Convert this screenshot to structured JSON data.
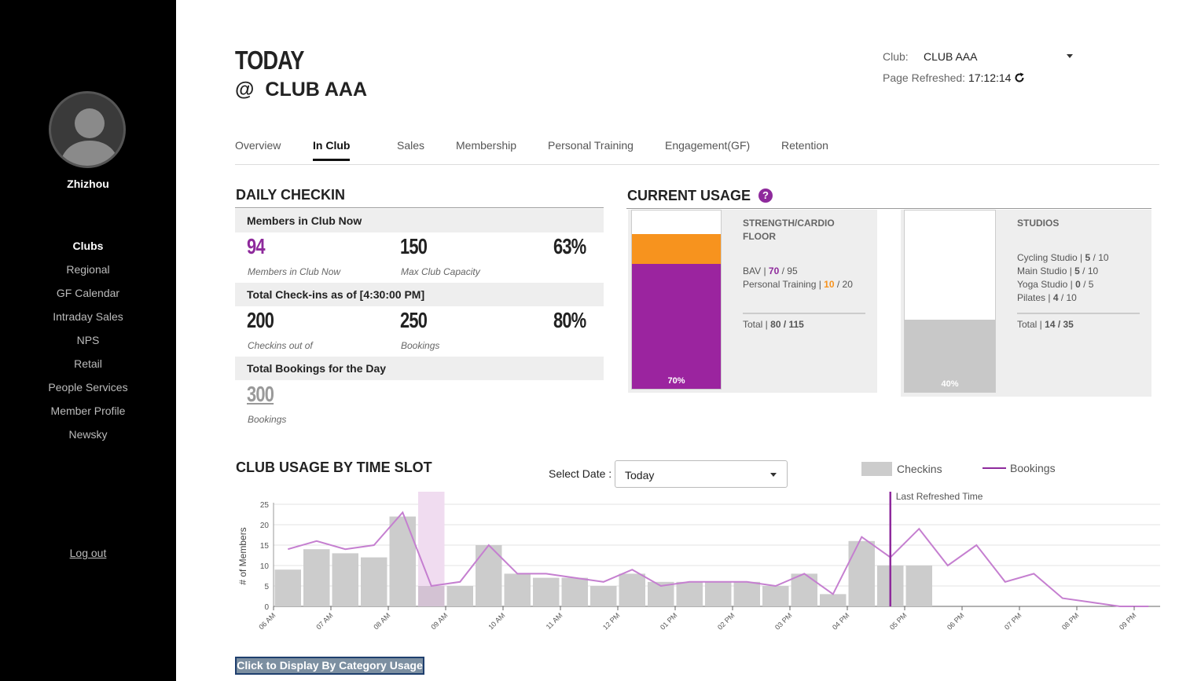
{
  "sidebar": {
    "username": "Zhizhou",
    "items": [
      {
        "label": "Clubs",
        "active": true
      },
      {
        "label": "Regional"
      },
      {
        "label": "GF Calendar"
      },
      {
        "label": "Intraday Sales"
      },
      {
        "label": "NPS"
      },
      {
        "label": "Retail"
      },
      {
        "label": "People Services"
      },
      {
        "label": "Member Profile"
      },
      {
        "label": "Newsky"
      }
    ],
    "logout": "Log out"
  },
  "header": {
    "title": "TODAY",
    "at": "@",
    "club": "CLUB AAA"
  },
  "club_select": {
    "label": "Club:",
    "value": "CLUB AAA"
  },
  "refresh": {
    "label": "Page Refreshed:",
    "time": "17:12:14",
    "icon": "refresh-icon"
  },
  "tabs": [
    "Overview",
    "In Club",
    "Sales",
    "Membership",
    "Personal Training",
    "Engagement(GF)",
    "Retention"
  ],
  "active_tab": "In Club",
  "daily_checkin": {
    "title": "DAILY CHECKIN",
    "members_header": "Members in Club Now",
    "members_now": "94",
    "members_now_cap": "Members in Club Now",
    "capacity": "150",
    "capacity_cap": "Max Club Capacity",
    "members_pct": "63%",
    "checkins_header": "Total Check-ins as of [4:30:00 PM]",
    "checkins": "200",
    "checkins_cap": "Checkins out of",
    "bookings": "250",
    "bookings_cap": "Bookings",
    "checkins_pct": "80%",
    "bookings_header": "Total Bookings for the Day",
    "day_bookings": "300",
    "day_bookings_cap": "Bookings"
  },
  "current_usage": {
    "title": "CURRENT USAGE",
    "help": "?",
    "floor": {
      "title1": "STRENGTH/CARDIO",
      "title2": "FLOOR",
      "l1a": "BAV | ",
      "l1b": "70",
      "l1c": " / 95",
      "l2a": "Personal Training | ",
      "l2b": "10",
      "l2c": " / 20",
      "l3a": "Total | ",
      "l3b": "80 / 115",
      "pct": "70%",
      "fill_purple": 0.7,
      "fill_orange": 0.17,
      "purple": "#9b249f",
      "orange": "#f7931e"
    },
    "studios": {
      "title": "STUDIOS",
      "lines": [
        {
          "a": "Cycling Studio | ",
          "b": "5",
          "c": " / 10"
        },
        {
          "a": "Main Studio | ",
          "b": "5",
          "c": " / 10"
        },
        {
          "a": "Yoga Studio | ",
          "b": "0",
          "c": " / 5"
        },
        {
          "a": "Pilates | ",
          "b": "4",
          "c": " / 10"
        }
      ],
      "total_a": "Total | ",
      "total_b": "14 / 35",
      "pct": "40%",
      "fill": 0.4
    }
  },
  "usage_chart": {
    "title": "CLUB USAGE BY TIME SLOT",
    "select_label": "Select Date :",
    "select_value": "Today",
    "legend_checkins": "Checkins",
    "legend_bookings": "Bookings",
    "refresh_label": "Last Refreshed Time"
  },
  "chart_data": {
    "type": "bar",
    "ylabel": "# of Members",
    "ylim": [
      0,
      25
    ],
    "yticks": [
      0,
      5,
      10,
      15,
      20,
      25
    ],
    "x_labels": [
      "06 AM",
      "07 AM",
      "08 AM",
      "09 AM",
      "10 AM",
      "11 AM",
      "12 PM",
      "01 PM",
      "02 PM",
      "03 PM",
      "04 PM",
      "05 PM",
      "06 PM",
      "07 PM",
      "08 PM",
      "09 PM"
    ],
    "slots": 32,
    "series": [
      {
        "name": "Checkins",
        "type": "bar",
        "values": [
          9,
          14,
          13,
          12,
          22,
          5,
          5,
          15,
          8,
          7,
          7,
          5,
          8,
          6,
          6,
          6,
          6,
          5,
          8,
          3,
          16,
          10,
          10,
          null,
          null,
          null,
          null,
          null,
          null,
          null,
          null,
          null
        ]
      },
      {
        "name": "Bookings",
        "type": "line",
        "values": [
          14,
          16,
          14,
          15,
          23,
          5,
          6,
          15,
          8,
          8,
          7,
          6,
          9,
          5,
          6,
          6,
          6,
          5,
          8,
          3,
          17,
          12,
          19,
          10,
          15,
          6,
          8,
          2,
          1,
          0,
          0,
          null
        ]
      }
    ],
    "highlight_slot": 5,
    "last_refreshed_slot": 21
  },
  "category_button": "Click to Display By Category Usage"
}
